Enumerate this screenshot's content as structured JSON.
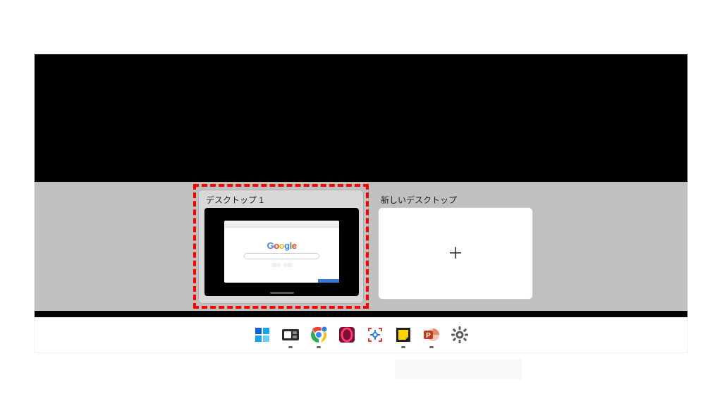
{
  "taskview": {
    "desktops": [
      {
        "label": "デスクトップ 1",
        "content_hint": "Google"
      }
    ],
    "new_desktop_label": "新しいデスクトップ",
    "plus_glyph": "＋"
  },
  "thumb": {
    "google_letters": [
      "G",
      "o",
      "o",
      "g",
      "l",
      "e"
    ]
  },
  "taskbar": {
    "icons": [
      {
        "name": "start-icon"
      },
      {
        "name": "task-view-icon"
      },
      {
        "name": "chrome-icon"
      },
      {
        "name": "opera-icon"
      },
      {
        "name": "snipping-tool-icon"
      },
      {
        "name": "sticky-notes-icon"
      },
      {
        "name": "powerpoint-icon"
      },
      {
        "name": "settings-icon"
      }
    ]
  },
  "colors": {
    "highlight": "#ff0000",
    "taskview_bg": "#c0c0c0",
    "card_bg": "#d8d8d8"
  }
}
